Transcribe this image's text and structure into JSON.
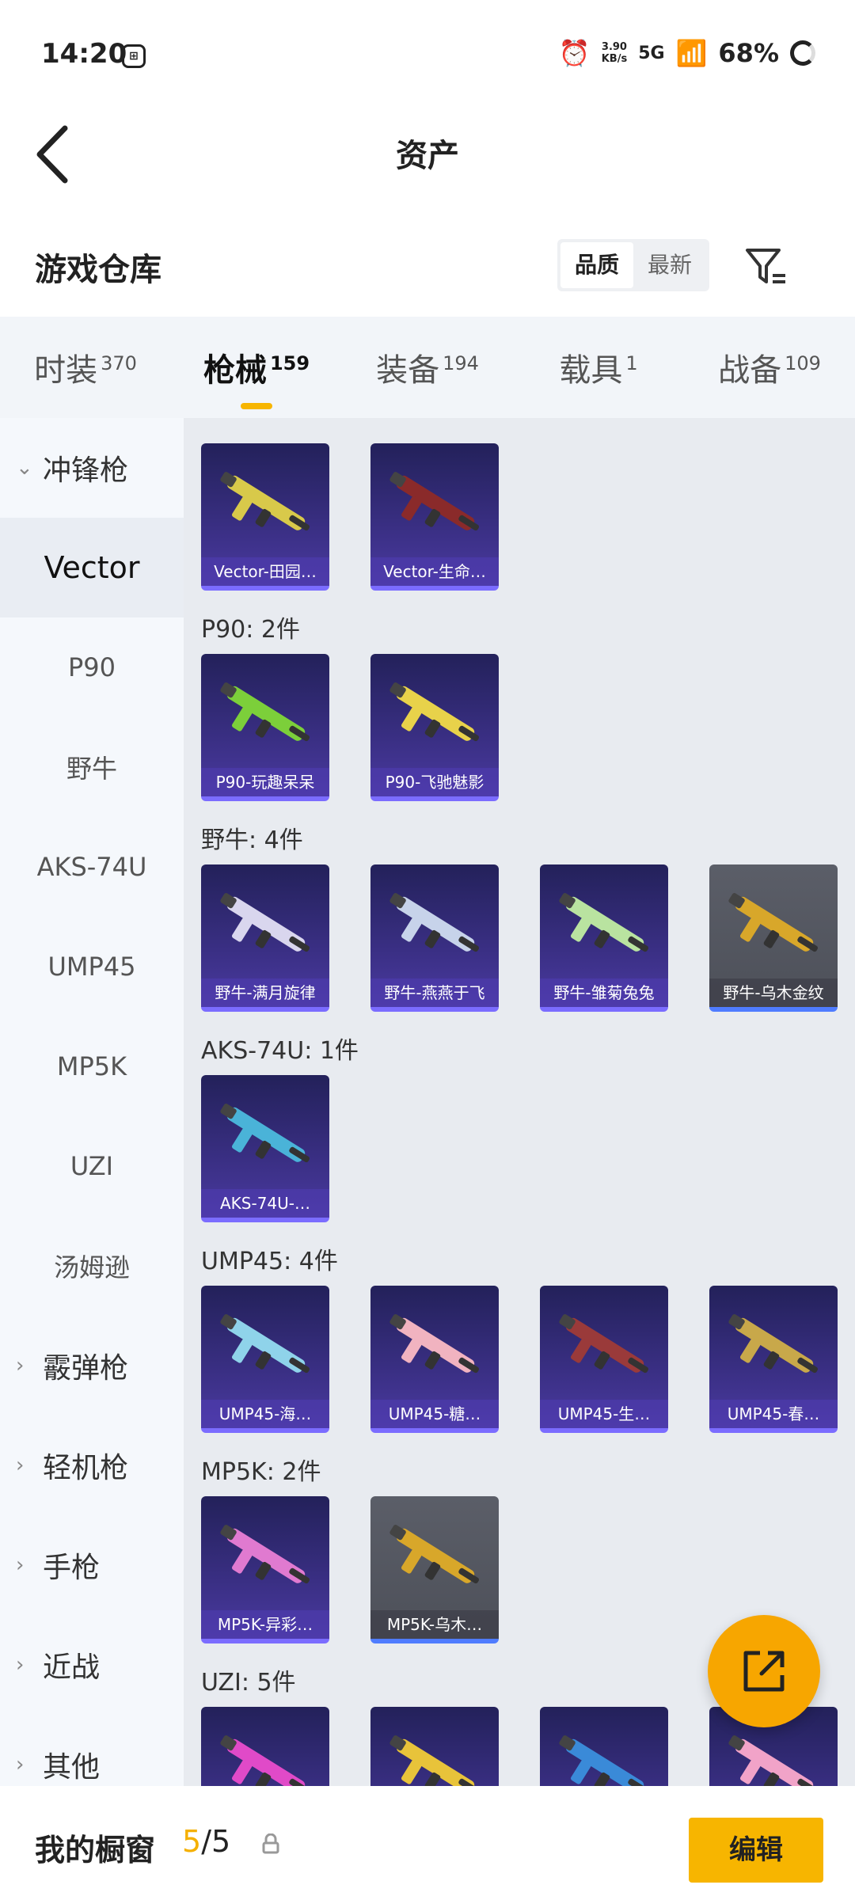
{
  "status": {
    "time": "14:20",
    "net_speed_value": "3.90",
    "net_speed_unit": "KB/s",
    "signal": "5G",
    "battery": "68%"
  },
  "header": {
    "title": "资产"
  },
  "warehouse": {
    "title": "游戏仓库",
    "sort_options": [
      "品质",
      "最新"
    ],
    "sort_active": "品质"
  },
  "tabs": [
    {
      "label": "时装",
      "count": "370"
    },
    {
      "label": "枪械",
      "count": "159",
      "active": true
    },
    {
      "label": "装备",
      "count": "194"
    },
    {
      "label": "载具",
      "count": "1"
    },
    {
      "label": "战备",
      "count": "109"
    }
  ],
  "sidebar": [
    {
      "label": "冲锋枪",
      "type": "category",
      "expanded": true
    },
    {
      "label": "Vector",
      "type": "item",
      "active": true
    },
    {
      "label": "P90",
      "type": "item"
    },
    {
      "label": "野牛",
      "type": "item"
    },
    {
      "label": "AKS-74U",
      "type": "item"
    },
    {
      "label": "UMP45",
      "type": "item"
    },
    {
      "label": "MP5K",
      "type": "item"
    },
    {
      "label": "UZI",
      "type": "item"
    },
    {
      "label": "汤姆逊",
      "type": "item"
    },
    {
      "label": "霰弹枪",
      "type": "category"
    },
    {
      "label": "轻机枪",
      "type": "category"
    },
    {
      "label": "手枪",
      "type": "category"
    },
    {
      "label": "近战",
      "type": "category"
    },
    {
      "label": "其他",
      "type": "category"
    }
  ],
  "groups": [
    {
      "label": "",
      "cards": [
        {
          "name": "Vector-田园…",
          "color": "#d8c94a"
        },
        {
          "name": "Vector-生命…",
          "color": "#8a2a2a"
        }
      ]
    },
    {
      "label": "P90: 2件",
      "cards": [
        {
          "name": "P90-玩趣呆呆",
          "color": "#7ccf3a"
        },
        {
          "name": "P90-飞驰魅影",
          "color": "#e8d24a"
        }
      ]
    },
    {
      "label": "野牛: 4件",
      "cards": [
        {
          "name": "野牛-满月旋律",
          "color": "#d9d6ee"
        },
        {
          "name": "野牛-燕燕于飞",
          "color": "#c7d3ea"
        },
        {
          "name": "野牛-雏菊兔兔",
          "color": "#b9e3a0"
        },
        {
          "name": "野牛-乌木金纹",
          "color": "#d8a72a",
          "gray": true
        }
      ]
    },
    {
      "label": "AKS-74U: 1件",
      "cards": [
        {
          "name": "AKS-74U-…",
          "color": "#4ab3d8"
        }
      ]
    },
    {
      "label": "UMP45: 4件",
      "cards": [
        {
          "name": "UMP45-海…",
          "color": "#8fd3ea"
        },
        {
          "name": "UMP45-糖…",
          "color": "#f1b3c0"
        },
        {
          "name": "UMP45-生…",
          "color": "#9a3a3a"
        },
        {
          "name": "UMP45-春…",
          "color": "#c8a84a"
        }
      ]
    },
    {
      "label": "MP5K: 2件",
      "cards": [
        {
          "name": "MP5K-异彩…",
          "color": "#e07ad0"
        },
        {
          "name": "MP5K-乌木…",
          "color": "#d8a72a",
          "gray": true
        }
      ]
    },
    {
      "label": "UZI: 5件",
      "cards": [
        {
          "name": "",
          "color": "#e04ac8"
        },
        {
          "name": "",
          "color": "#e8c33a"
        },
        {
          "name": "",
          "color": "#3a8ad8"
        },
        {
          "name": "",
          "color": "#f1a3c8"
        }
      ]
    }
  ],
  "bottom": {
    "label": "我的橱窗",
    "count_current": "5",
    "count_total": "/5",
    "edit_label": "编辑"
  }
}
